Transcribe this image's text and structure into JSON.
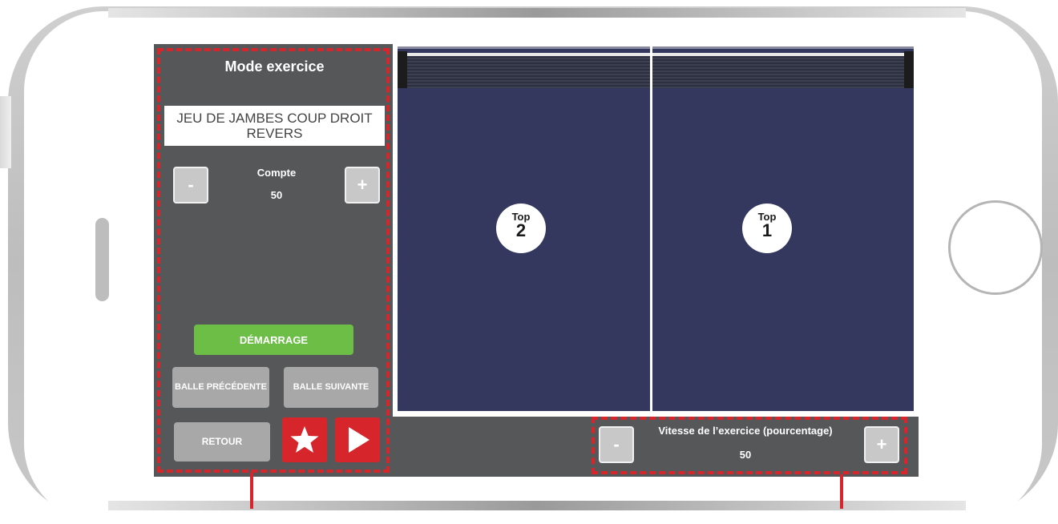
{
  "panel": {
    "title": "Mode exercice",
    "drill_name": "JEU DE JAMBES COUP DROIT REVERS",
    "count": {
      "label": "Compte",
      "value": "50",
      "minus": "-",
      "plus": "+"
    },
    "start_button": "DÉMARRAGE",
    "prev_ball": "BALLE PRÉCÉDENTE",
    "next_ball": "BALLE SUIVANTE",
    "back_button": "RETOUR"
  },
  "zones": [
    {
      "top": "Top",
      "number": "2"
    },
    {
      "top": "Top",
      "number": "1"
    }
  ],
  "speed": {
    "label": "Vitesse de l’exercice (pourcentage)",
    "value": "50",
    "minus": "-",
    "plus": "+"
  },
  "colors": {
    "accent_red": "#d7262b",
    "start_green": "#6cbe46",
    "table_blue": "#34385f",
    "panel_gray": "#555759"
  },
  "icons": {
    "favorite": "star-icon",
    "play": "play-icon"
  }
}
